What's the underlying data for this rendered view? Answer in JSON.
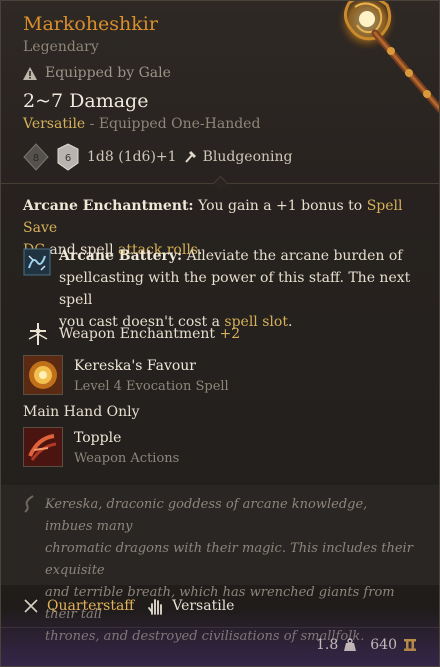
{
  "item": {
    "name": "Markoheshkir",
    "rarity": "Legendary",
    "equipped_by": "Equipped by Gale",
    "damage": "2~7 Damage",
    "versatile": "Versatile",
    "equipped_mode": "- Equipped One-Handed",
    "dice_formula": "1d8 (1d6)+1",
    "damage_type": "Bludgeoning"
  },
  "enchantment": {
    "label": "Arcane Enchantment:",
    "text_1": "You gain a +1 bonus to",
    "link_1": "Spell Save",
    "link_1b": "DC",
    "text_2": "and spell",
    "link_2": "attack rolls",
    "text_3": "."
  },
  "battery": {
    "label": "Arcane Battery:",
    "line_1": "Alleviate the arcane burden of",
    "line_2": "spellcasting with the power of this staff. The next spell",
    "line_3_pre": "you cast doesn't cost a",
    "link": "spell slot",
    "line_3_post": "."
  },
  "weapon_enchant": {
    "label": "Weapon Enchantment",
    "bonus": "+2"
  },
  "spell": {
    "name": "Kereska's Favour",
    "sub": "Level 4 Evocation Spell"
  },
  "main_hand": "Main Hand Only",
  "action": {
    "name": "Topple",
    "sub": "Weapon Actions"
  },
  "lore": {
    "line_1": "Kereska, draconic goddess of arcane knowledge, imbues many",
    "line_2": "chromatic dragons with their magic. This includes their exquisite",
    "line_3": "and terrible breath, which has wrenched giants from their tall",
    "line_4": "thrones, and destroyed civilisations of smallfolk."
  },
  "properties": {
    "type": "Quarterstaff",
    "trait": "Versatile"
  },
  "footer": {
    "weight": "1.8",
    "value": "640"
  },
  "colors": {
    "title": "#d98f2c",
    "accent": "#d6b15a",
    "muted": "#8f867a"
  }
}
